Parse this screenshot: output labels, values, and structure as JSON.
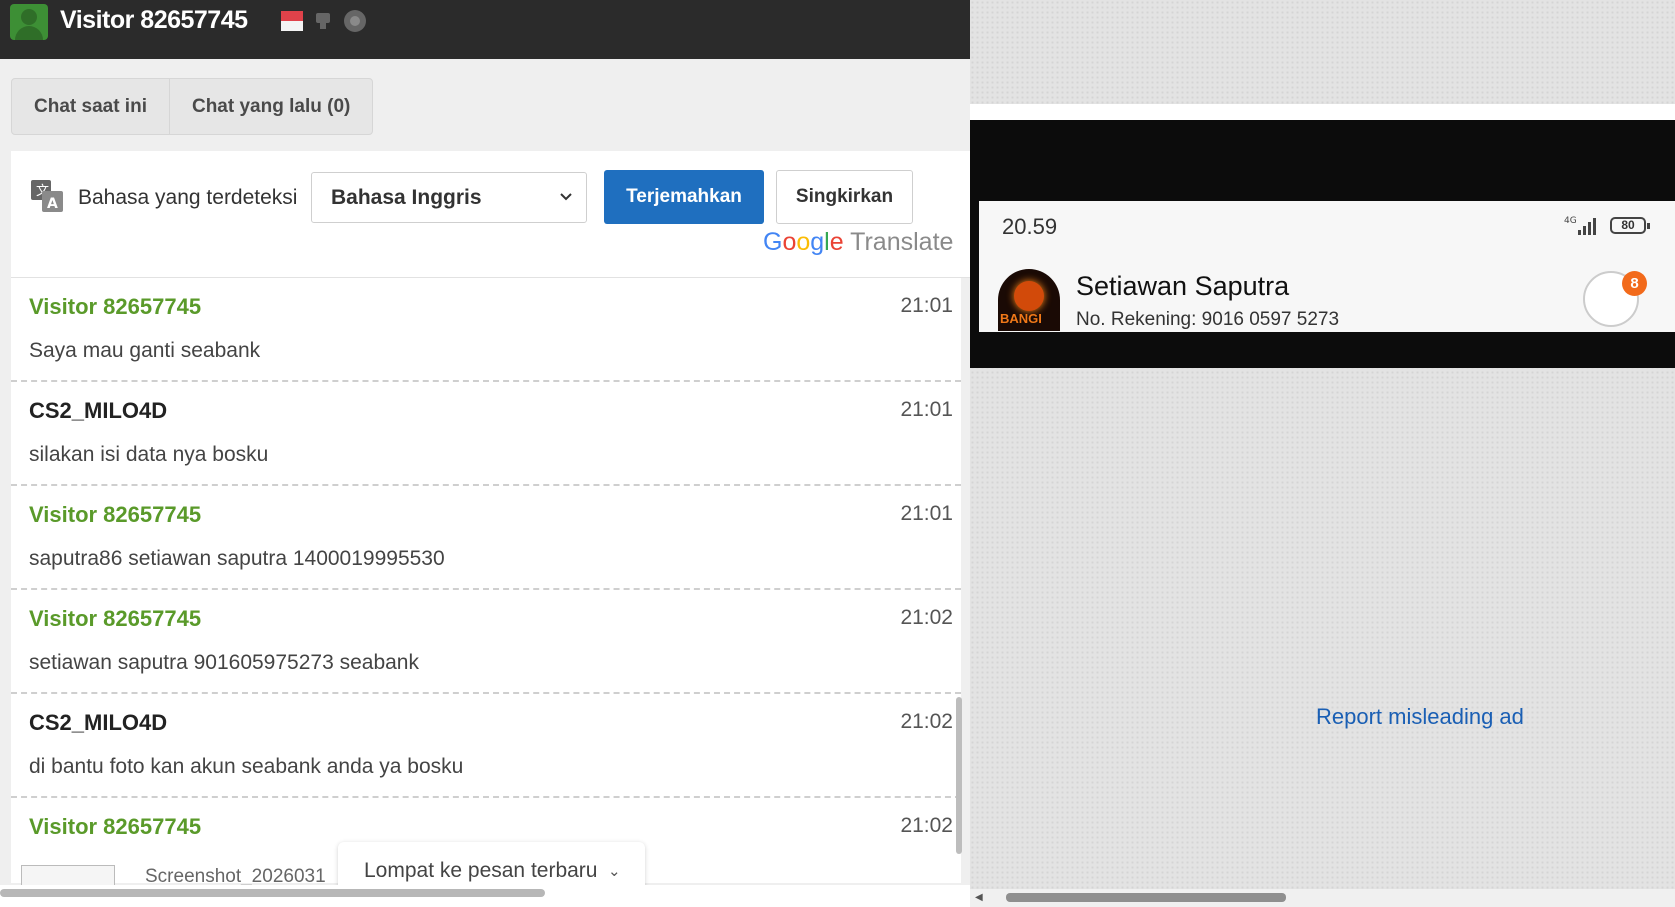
{
  "header": {
    "visitor_title": "Visitor 82657745",
    "icons": [
      "avatar-icon",
      "indonesia-flag-icon",
      "device-icon",
      "browser-icon"
    ]
  },
  "tabs": [
    {
      "label": "Chat saat ini"
    },
    {
      "label": "Chat yang lalu (0)"
    }
  ],
  "translate": {
    "detected_label": "Bahasa yang terdeteksi",
    "language_value": "Bahasa Inggris",
    "translate_button": "Terjemahkan",
    "dismiss_button": "Singkirkan",
    "powered_by": {
      "google": "Google",
      "translate": "Translate"
    }
  },
  "messages": [
    {
      "sender": "Visitor 82657745",
      "role": "visitor",
      "time": "21:01",
      "text": "Saya mau ganti seabank"
    },
    {
      "sender": "CS2_MILO4D",
      "role": "agent",
      "time": "21:01",
      "text": "silakan isi data nya bosku"
    },
    {
      "sender": "Visitor 82657745",
      "role": "visitor",
      "time": "21:01",
      "text": "saputra86 setiawan saputra 1400019995530"
    },
    {
      "sender": "Visitor 82657745",
      "role": "visitor",
      "time": "21:02",
      "text": "setiawan saputra 901605975273 seabank"
    },
    {
      "sender": "CS2_MILO4D",
      "role": "agent",
      "time": "21:02",
      "text": "di bantu foto kan akun seabank anda ya bosku"
    },
    {
      "sender": "Visitor 82657745",
      "role": "visitor",
      "time": "21:02",
      "text": ""
    }
  ],
  "partial_attachment_text": "Screenshot_2026031",
  "jump_button": {
    "label": "Lompat ke pesan terbaru"
  },
  "ad": {
    "phone_time": "20.59",
    "network": "4G",
    "battery": "80",
    "contact_name": "Setiawan Saputra",
    "account_number": "No. Rekening: 9016 0597 5273",
    "badge_count": "8",
    "report_link": "Report misleading ad"
  },
  "colors": {
    "titlebar": "#2b2b2b",
    "visitor_name": "#5a9a2a",
    "translate_button": "#1f6fbf",
    "badge": "#f26a1b",
    "link": "#1a5fb4"
  }
}
